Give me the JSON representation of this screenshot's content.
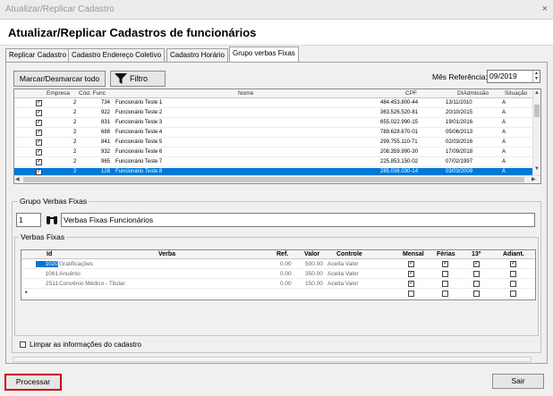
{
  "window": {
    "title": "Atualizar/Replicar Cadastro",
    "close_glyph": "×"
  },
  "heading": "Atualizar/Replicar Cadastros de funcionários",
  "tabs": [
    "Replicar Cadastro",
    "Cadastro Endereço Coletivo",
    "Cadastro Horário",
    "Grupo verbas Fixas"
  ],
  "active_tab": "Grupo verbas Fixas",
  "toolbar": {
    "mark_all": "Marcar/Desmarcar todo",
    "filter": "Filtro",
    "filter_icon": "funnel-icon",
    "mes_label": "Mês Referência:",
    "mes_value": "09/2019"
  },
  "employees": {
    "columns": [
      "Empresa",
      "Cód. Func",
      "Nome",
      "CPF",
      "DtAdmissão",
      "Situação"
    ],
    "rows": [
      {
        "empresa": "2",
        "cod": "734",
        "nome": "Funcionário Teste 1",
        "cpf": "484.453.800-44",
        "adm": "13/11/2010",
        "sit": "A",
        "checked": true
      },
      {
        "empresa": "2",
        "cod": "922",
        "nome": "Funcionário Teste 2",
        "cpf": "363.526.520-81",
        "adm": "20/10/2015",
        "sit": "A",
        "checked": true
      },
      {
        "empresa": "2",
        "cod": "831",
        "nome": "Funcionário Teste 3",
        "cpf": "655.022.990-15",
        "adm": "19/01/2016",
        "sit": "A",
        "checked": true
      },
      {
        "empresa": "2",
        "cod": "688",
        "nome": "Funcionário Teste 4",
        "cpf": "789.628.670-01",
        "adm": "05/06/2013",
        "sit": "A",
        "checked": true
      },
      {
        "empresa": "2",
        "cod": "841",
        "nome": "Funcionário Teste 5",
        "cpf": "299.755.110-71",
        "adm": "02/03/2016",
        "sit": "A",
        "checked": true
      },
      {
        "empresa": "2",
        "cod": "932",
        "nome": "Funcionário Teste 6",
        "cpf": "208.359.990-30",
        "adm": "17/09/2018",
        "sit": "A",
        "checked": true
      },
      {
        "empresa": "2",
        "cod": "965",
        "nome": "Funcionário Teste 7",
        "cpf": "225.853.150-02",
        "adm": "07/02/1997",
        "sit": "A",
        "checked": true
      },
      {
        "empresa": "2",
        "cod": "128",
        "nome": "Funcionário Teste 8",
        "cpf": "285.036.030-14",
        "adm": "03/03/2009",
        "sit": "A",
        "checked": true
      }
    ]
  },
  "grupo": {
    "title": "Grupo Verbas Fixas",
    "code": "1",
    "search_icon": "binoculars-icon",
    "name": "Verbas Fixas Funcionários"
  },
  "verbas": {
    "title": "Verbas Fixas",
    "columns": [
      "Id",
      "Verba",
      "Ref.",
      "Valor",
      "Controle",
      "Mensal",
      "Férias",
      "13º",
      "Adiant."
    ],
    "rows": [
      {
        "id": "1020",
        "verba": "Gratificações",
        "ref": "0.00",
        "valor": "500.00",
        "controle": "Aceita Valor",
        "mensal": true,
        "ferias": true,
        "decimo": true,
        "adiant": true
      },
      {
        "id": "1061",
        "verba": "Anuênio",
        "ref": "0.00",
        "valor": "350.00",
        "controle": "Aceita Valor",
        "mensal": true,
        "ferias": false,
        "decimo": false,
        "adiant": false
      },
      {
        "id": "2511",
        "verba": "Convênio Médico - Titular",
        "ref": "0.00",
        "valor": "150.00",
        "controle": "Aceita Valor",
        "mensal": true,
        "ferias": false,
        "decimo": false,
        "adiant": false
      }
    ],
    "new_row_glyph": "*"
  },
  "limpar_label": "Limpar as informações do cadastro",
  "buttons": {
    "processar": "Processar",
    "sair": "Sair"
  },
  "colors": {
    "selection": "#0078d7",
    "highlight_border": "#cc0000"
  }
}
